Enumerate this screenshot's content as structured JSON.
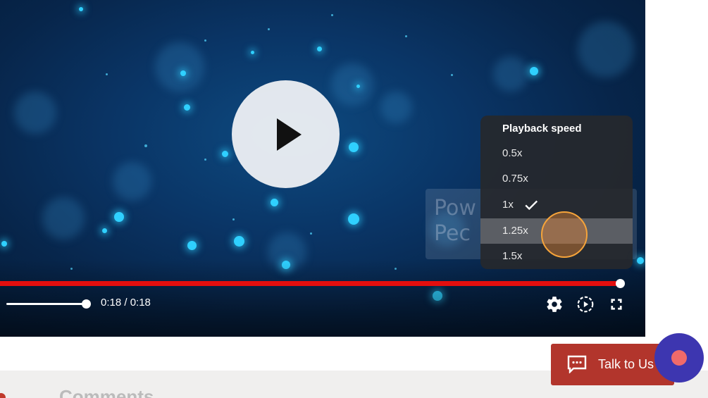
{
  "player": {
    "time_display": "0:18 / 0:18",
    "progress_fraction": 1.0,
    "volume_fraction": 1.0,
    "watermark_text": "Pow\nPec"
  },
  "speed_menu": {
    "title": "Playback speed",
    "options": [
      "0.5x",
      "0.75x",
      "1x",
      "1.25x",
      "1.5x"
    ],
    "selected": "1x",
    "hovered": "1.25x"
  },
  "page": {
    "comments_title": "Comments",
    "talk_button_label": "Talk to Us"
  },
  "icons": {
    "play": "play-icon",
    "settings": "gear-icon",
    "speed": "playback-speed-icon",
    "fullscreen": "fullscreen-icon",
    "check": "check-icon",
    "chat": "chat-icon"
  },
  "colors": {
    "progress": "#e30e0e",
    "talk_button": "#b2352c",
    "avatar_bubble": "#3d36b0",
    "cursor": "#f6a43a"
  }
}
